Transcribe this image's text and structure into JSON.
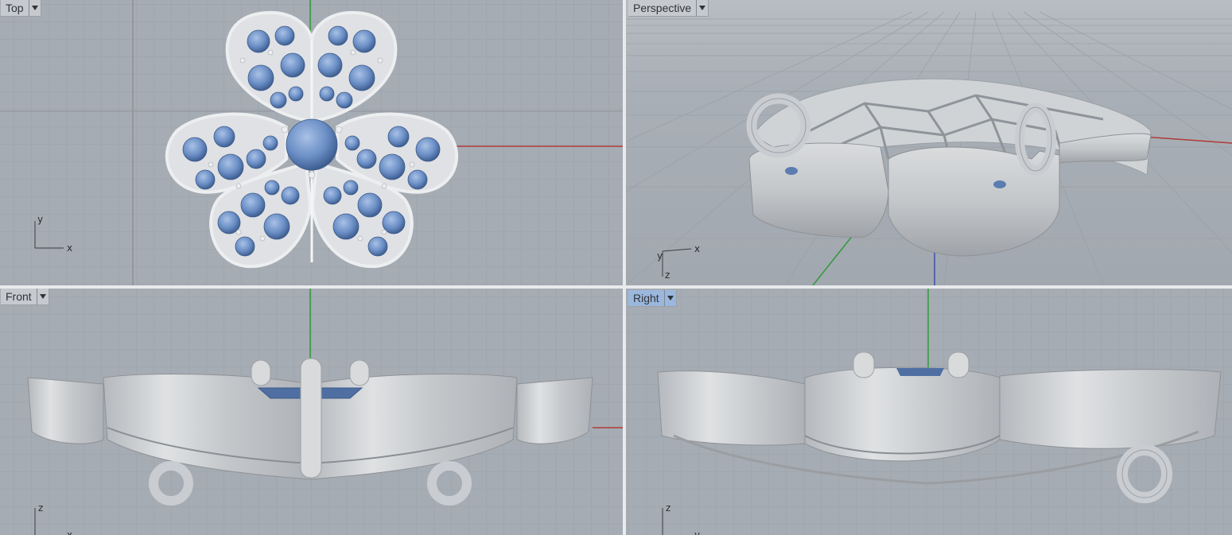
{
  "viewports": {
    "top": {
      "label": "Top",
      "active": false,
      "axes": [
        "y",
        "x"
      ]
    },
    "perspective": {
      "label": "Perspective",
      "active": false,
      "axes": [
        "y",
        "x",
        "z"
      ]
    },
    "front": {
      "label": "Front",
      "active": false,
      "axes": [
        "z",
        "x"
      ]
    },
    "right": {
      "label": "Right",
      "active": true,
      "axes": [
        "z",
        "y"
      ]
    }
  },
  "icons": {
    "viewport_menu": "chevron-down-icon"
  },
  "colors": {
    "viewport_bg": "#a6acb3",
    "active_label_bg": "#9bb7dd",
    "metal": "#c9cccf",
    "gem": "#6b8fc6",
    "x_axis": "#b03a3a",
    "y_axis": "#2f9a3a",
    "z_axis": "#3a4fb0"
  }
}
